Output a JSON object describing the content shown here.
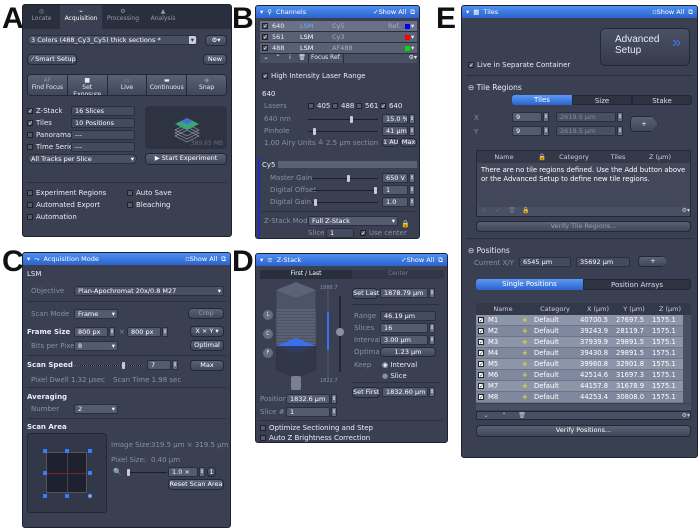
{
  "labels": {
    "a": "A",
    "b": "B",
    "c": "C",
    "d": "D",
    "e": "E"
  },
  "panelA": {
    "tabs": [
      {
        "label": "Locate",
        "icon": "locate-icon"
      },
      {
        "label": "Acquisition",
        "icon": "microscope-icon",
        "active": true
      },
      {
        "label": "Processing",
        "icon": "processing-icon"
      },
      {
        "label": "Analysis",
        "icon": "analysis-icon"
      }
    ],
    "config": "3 Colors (488_Cy3_Cy5) thick sections *",
    "smart_setup": "Smart Setup",
    "new": "New",
    "actions": [
      {
        "label": "Find Focus",
        "icon": "AF"
      },
      {
        "label": "Set Exposure",
        "icon": "camera"
      },
      {
        "label": "Live",
        "icon": "live"
      },
      {
        "label": "Continuous",
        "icon": "cont"
      },
      {
        "label": "Snap",
        "icon": "snap"
      }
    ],
    "options": [
      {
        "label": "Z-Stack",
        "checked": true,
        "value": "16 Slices"
      },
      {
        "label": "Tiles",
        "checked": true,
        "value": "10 Positions"
      },
      {
        "label": "Panorama",
        "checked": false,
        "value": "---"
      },
      {
        "label": "Time Series",
        "checked": false,
        "value": "---"
      }
    ],
    "tracks": "All Tracks per Slice",
    "size": "389.65 MB",
    "start": "Start Experiment",
    "extras": [
      {
        "label": "Experiment Regions"
      },
      {
        "label": "Auto Save"
      },
      {
        "label": "Automated Export"
      },
      {
        "label": "Bleaching"
      },
      {
        "label": "Automation"
      }
    ]
  },
  "panelB": {
    "title": "Channels",
    "show_all": "Show All",
    "channels": [
      {
        "wl": "640",
        "type": "LSM",
        "name": "Cy5",
        "ref": "Ref.",
        "color": "#0000ff"
      },
      {
        "wl": "561",
        "type": "LSM",
        "name": "Cy3",
        "ref": "",
        "color": "#ff0000"
      },
      {
        "wl": "488",
        "type": "LSM",
        "name": "AF488",
        "ref": "",
        "color": "#00dd00"
      }
    ],
    "focus_ref": "Focus Ref.",
    "high_intensity": "High Intensity Laser Range",
    "laser_section": "640",
    "lasers_label": "Lasers",
    "lasers": [
      {
        "wl": "405",
        "on": false
      },
      {
        "wl": "488",
        "on": false
      },
      {
        "wl": "561",
        "on": false
      },
      {
        "wl": "640",
        "on": true
      }
    ],
    "power_label": "640 nm",
    "power": "15.0 %",
    "power_frac": 0.62,
    "pinhole_label": "Pinhole",
    "pinhole": "41 µm",
    "pinhole_frac": 0.08,
    "airy": "1.00 Airy Units ≙ 2.5 µm section",
    "au_btn": "1 AU",
    "max_btn": "Max",
    "dye": "Cy5",
    "gain_label": "Master Gain",
    "gain": "650 V",
    "gain_frac": 0.55,
    "offset_label": "Digital Offset",
    "offset": "1",
    "offset_frac": 0.95,
    "dgain_label": "Digital Gain",
    "dgain": "1.0",
    "dgain_frac": 0.05,
    "zmode_label": "Z-Stack Mode",
    "zmode": "Full Z-Stack",
    "slice_label": "Slice #",
    "slice": "1",
    "use_center": "Use center"
  },
  "panelC": {
    "title": "Acquisition Mode",
    "show_all": "Show All",
    "lsm": "LSM",
    "objective_label": "Objective",
    "objective": "Plan-Apochromat 20x/0.8 M27",
    "scan_mode_label": "Scan Mode",
    "scan_mode": "Frame",
    "crop": "Crop",
    "frame_label": "Frame Size",
    "frame_x": "800 px",
    "frame_y": "800 px",
    "xy": "X × Y",
    "bits_label": "Bits per Pixel",
    "bits": "8",
    "optimal": "Optimal",
    "speed_label": "Scan Speed",
    "speed": "7",
    "speed_frac": 0.7,
    "max": "Max",
    "dwell": "Pixel Dwell 1.32 µsec",
    "scan_time": "Scan Time 1.98 sec",
    "averaging": "Averaging",
    "number_label": "Number",
    "number": "2",
    "scan_area": "Scan Area",
    "image_size_label": "Image Size:",
    "image_size": "319.5 µm × 319.5 µm",
    "pixel_size_label": "Pixel Size:",
    "pixel_size": "0.40 µm",
    "zoom": "1.0 ×",
    "one": "1",
    "reset": "Reset Scan Area"
  },
  "panelD": {
    "title": "Z-Stack",
    "show_all": "Show All",
    "tabs": [
      "First / Last",
      "Center"
    ],
    "top_val": "1888.7",
    "bottom_val": "1822.7",
    "set_last": "Set Last",
    "last": "1878.79 µm",
    "range_label": "Range",
    "range": "46.19 µm",
    "slices_label": "Slices",
    "slices": "16",
    "interval_label": "Interval",
    "interval": "3.00 µm",
    "optimal_label": "Optimal",
    "optimal": "1.23 µm",
    "keep_label": "Keep",
    "keep_interval": "Interval",
    "keep_slice": "Slice",
    "set_first": "Set First",
    "first": "1832.60 µm",
    "position_label": "Position",
    "position": "1832.6 µm",
    "slice_label": "Slice #",
    "slice": "1",
    "opt_section": "Optimize Sectioning and Step",
    "auto_z": "Auto Z Brightness Correction",
    "markers": [
      "L",
      "C",
      "F"
    ]
  },
  "panelE": {
    "title": "Tiles",
    "show_all": "Show All",
    "advanced": "Advanced Setup",
    "live_sep": "Live in Separate Container",
    "tile_regions": "Tile Regions",
    "tabs": [
      "Tiles",
      "Size",
      "Stake"
    ],
    "x_label": "X",
    "x": "9",
    "x_um": "2619.5 µm",
    "y_label": "Y",
    "y": "9",
    "y_um": "2619.5 µm",
    "add": "+",
    "tile_cols": [
      "Name",
      "",
      "Category",
      "Tiles",
      "Z (µm)"
    ],
    "empty_msg": "There are no tile regions defined. Use the Add button above or the Advanced Setup to define new tile regions.",
    "verify_tiles": "Verify Tile Regions...",
    "positions": "Positions",
    "current_label": "Current X/Y",
    "cur_x": "6545 µm",
    "cur_y": "35692 µm",
    "pos_tabs": [
      "Single Positions",
      "Position Arrays"
    ],
    "pos_cols": [
      "Name",
      "",
      "Category",
      "X (µm)",
      "Y (µm)",
      "Z (µm)"
    ],
    "rows": [
      {
        "name": "M1",
        "cat": "Default",
        "x": "40700.5",
        "y": "27697.5",
        "z": "1575.1"
      },
      {
        "name": "M2",
        "cat": "Default",
        "x": "39243.9",
        "y": "28119.7",
        "z": "1575.1"
      },
      {
        "name": "M3",
        "cat": "Default",
        "x": "37939.9",
        "y": "29891.5",
        "z": "1575.1"
      },
      {
        "name": "M4",
        "cat": "Default",
        "x": "39430.8",
        "y": "29891.5",
        "z": "1575.1"
      },
      {
        "name": "M5",
        "cat": "Default",
        "x": "39960.8",
        "y": "32901.8",
        "z": "1575.1"
      },
      {
        "name": "M6",
        "cat": "Default",
        "x": "42514.6",
        "y": "31697.3",
        "z": "1575.1"
      },
      {
        "name": "M7",
        "cat": "Default",
        "x": "44157.8",
        "y": "31678.9",
        "z": "1575.1"
      },
      {
        "name": "M8",
        "cat": "Default",
        "x": "44253.4",
        "y": "30808.0",
        "z": "1575.1"
      }
    ],
    "verify_positions": "Verify Positions..."
  }
}
